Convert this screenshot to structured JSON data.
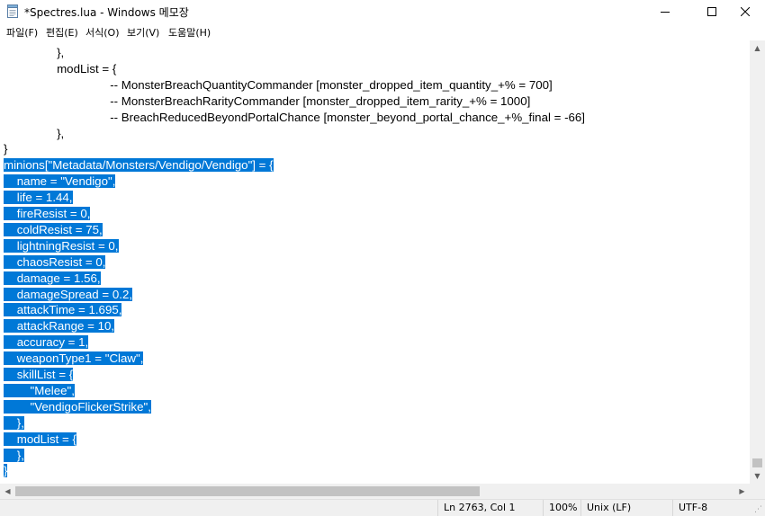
{
  "window": {
    "title": "*Spectres.lua - Windows 메모장",
    "app_icon": "notepad-icon",
    "minimize_icon": "minimize-icon",
    "maximize_icon": "maximize-icon",
    "close_icon": "close-icon"
  },
  "menu": [
    {
      "label": "파일(F)"
    },
    {
      "label": "편집(E)"
    },
    {
      "label": "서식(O)"
    },
    {
      "label": "보기(V)"
    },
    {
      "label": "도움말(H)"
    }
  ],
  "editor": {
    "selection_color": "#0078d7",
    "lines": [
      {
        "text": "\t},",
        "selected": false
      },
      {
        "text": "\tmodList = {",
        "selected": false
      },
      {
        "text": "\t\t-- MonsterBreachQuantityCommander [monster_dropped_item_quantity_+% = 700]",
        "selected": false
      },
      {
        "text": "\t\t-- MonsterBreachRarityCommander [monster_dropped_item_rarity_+% = 1000]",
        "selected": false
      },
      {
        "text": "\t\t-- BreachReducedBeyondPortalChance [monster_beyond_portal_chance_+%_final = -66]",
        "selected": false
      },
      {
        "text": "\t},",
        "selected": false
      },
      {
        "text": "}",
        "selected": false
      },
      {
        "text": "minions[\"Metadata/Monsters/Vendigo/Vendigo\"] = {",
        "selected": true
      },
      {
        "text": "    name = \"Vendigo\",",
        "selected": true
      },
      {
        "text": "    life = 1.44,",
        "selected": true
      },
      {
        "text": "    fireResist = 0,",
        "selected": true
      },
      {
        "text": "    coldResist = 75,",
        "selected": true
      },
      {
        "text": "    lightningResist = 0,",
        "selected": true
      },
      {
        "text": "    chaosResist = 0,",
        "selected": true
      },
      {
        "text": "    damage = 1.56,",
        "selected": true
      },
      {
        "text": "    damageSpread = 0.2,",
        "selected": true
      },
      {
        "text": "    attackTime = 1.695,",
        "selected": true
      },
      {
        "text": "    attackRange = 10,",
        "selected": true
      },
      {
        "text": "    accuracy = 1,",
        "selected": true
      },
      {
        "text": "    weaponType1 = \"Claw\",",
        "selected": true
      },
      {
        "text": "    skillList = {",
        "selected": true
      },
      {
        "text": "        \"Melee\",",
        "selected": true
      },
      {
        "text": "        \"VendigoFlickerStrike\",",
        "selected": true
      },
      {
        "text": "    },",
        "selected": true
      },
      {
        "text": "    modList = {",
        "selected": true
      },
      {
        "text": "    },",
        "selected": true
      },
      {
        "text": "}",
        "selected": true
      }
    ]
  },
  "statusbar": {
    "position": "Ln 2763, Col 1",
    "zoom": "100%",
    "line_ending": "Unix (LF)",
    "encoding": "UTF-8"
  }
}
